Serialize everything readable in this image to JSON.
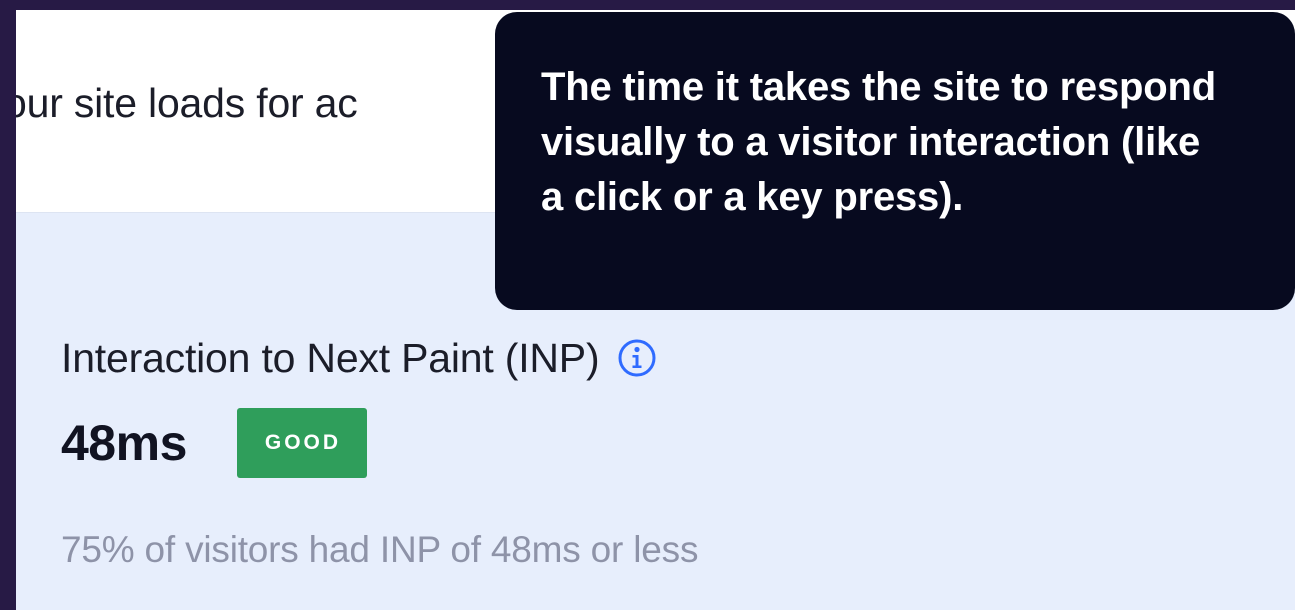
{
  "intro": {
    "text": "our site loads for ac"
  },
  "metric": {
    "title": "Interaction to Next Paint (INP)",
    "info_icon": "info-circle-icon",
    "value": "48ms",
    "status": "GOOD",
    "description": "75% of visitors had INP of 48ms or less"
  },
  "tooltip": {
    "text": "The time it takes the site to respond visually to a visitor interaction (like a click or a key press)."
  },
  "colors": {
    "background": "#271a45",
    "card": "#e7eefc",
    "badge": "#2f9e5b",
    "tooltip": "#070a1f",
    "info_icon": "#2f6bff"
  }
}
